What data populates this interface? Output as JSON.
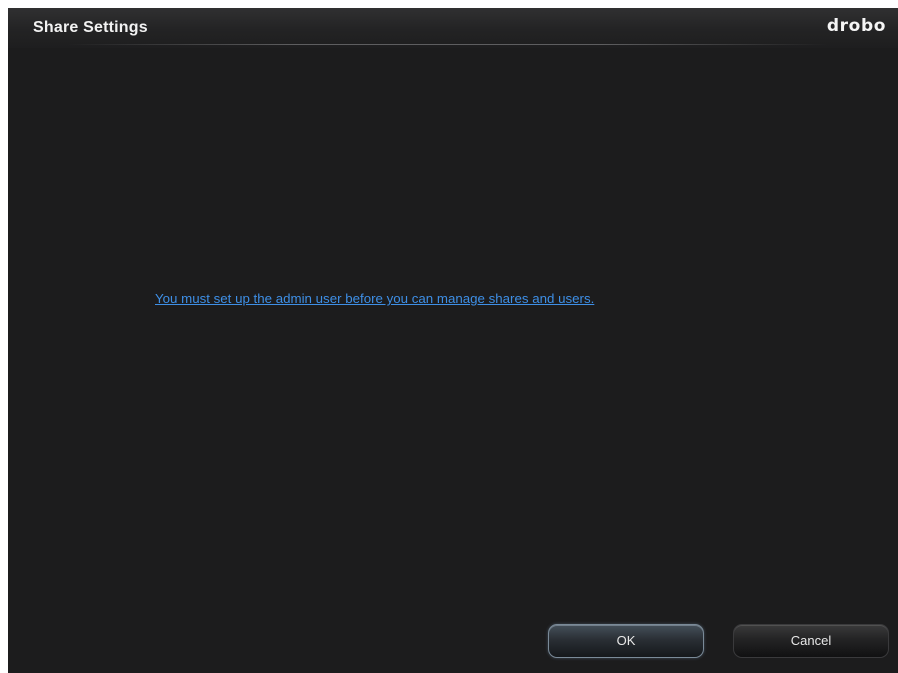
{
  "dialog": {
    "title": "Share Settings",
    "logo_text": "drobo",
    "message": "You must set up the admin user before you can manage shares and users."
  },
  "buttons": {
    "ok_label": "OK",
    "cancel_label": "Cancel"
  },
  "colors": {
    "background": "#1c1c1d",
    "link": "#3e8fe6",
    "title_text": "#f2f2f2"
  }
}
